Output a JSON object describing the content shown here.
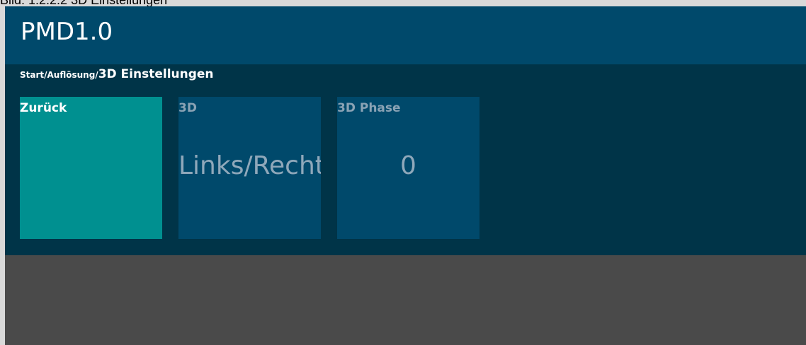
{
  "caption": "Bild: 1.2.2.2 3D Einstellungen",
  "header": {
    "app_title": "PMD1.0"
  },
  "breadcrumb": {
    "path": "Start/Auflösung/",
    "current": "3D Einstellungen"
  },
  "tiles": [
    {
      "label": "Zurück",
      "value": ""
    },
    {
      "label": "3D",
      "value": "Links/Rechts"
    },
    {
      "label": "3D Phase",
      "value": "0"
    }
  ],
  "colors": {
    "header": "#00496b",
    "content": "#003448",
    "back_tile": "#009090",
    "setting_tile": "#00496b",
    "footer": "#4a4a4a"
  }
}
